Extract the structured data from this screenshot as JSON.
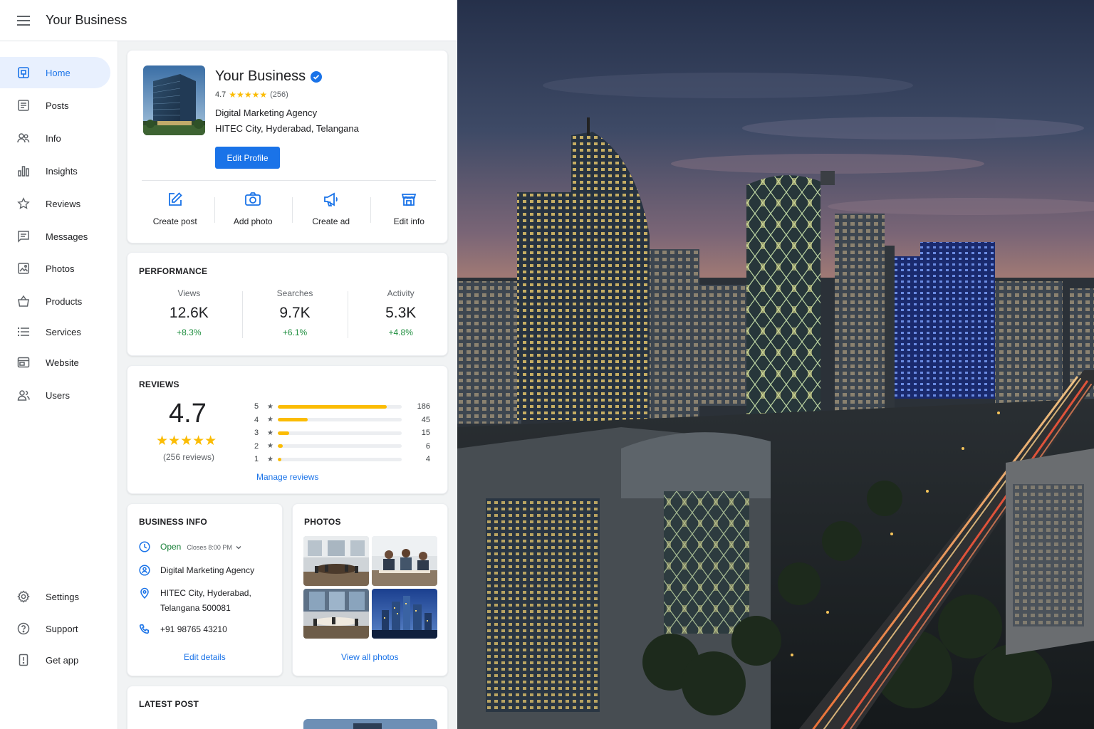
{
  "topbar": {
    "title": "Your Business"
  },
  "sidebar": {
    "items": [
      {
        "label": "Home",
        "icon": "home-icon",
        "active": true
      },
      {
        "label": "Posts",
        "icon": "posts-icon"
      },
      {
        "label": "Info",
        "icon": "info-icon"
      },
      {
        "label": "Insights",
        "icon": "insights-icon"
      },
      {
        "label": "Reviews",
        "icon": "star-icon"
      },
      {
        "label": "Messages",
        "icon": "messages-icon"
      },
      {
        "label": "Photos",
        "icon": "photos-icon"
      },
      {
        "label": "Products",
        "icon": "products-icon"
      },
      {
        "label": "Services",
        "icon": "services-icon"
      },
      {
        "label": "Website",
        "icon": "website-icon"
      },
      {
        "label": "Users",
        "icon": "users-icon"
      }
    ],
    "footer": [
      {
        "label": "Settings",
        "icon": "gear-icon"
      },
      {
        "label": "Support",
        "icon": "help-icon"
      },
      {
        "label": "Get app",
        "icon": "phone-icon"
      }
    ]
  },
  "profile": {
    "name": "Your Business",
    "rating": "4.7",
    "stars": "★★★★★",
    "rating_count": "(256)",
    "category": "Digital Marketing Agency",
    "address": "HITEC City, Hyderabad, Telangana",
    "edit_button": "Edit Profile",
    "actions": [
      {
        "label": "Create post",
        "icon": "edit-icon"
      },
      {
        "label": "Add photo",
        "icon": "camera-icon"
      },
      {
        "label": "Create ad",
        "icon": "megaphone-icon"
      },
      {
        "label": "Edit info",
        "icon": "storefront-icon"
      }
    ]
  },
  "performance": {
    "title": "PERFORMANCE",
    "metrics": [
      {
        "label": "Views",
        "value": "12.6K",
        "change": "+8.3%"
      },
      {
        "label": "Searches",
        "value": "9.7K",
        "change": "+6.1%"
      },
      {
        "label": "Activity",
        "value": "5.3K",
        "change": "+4.8%"
      }
    ]
  },
  "reviews": {
    "title": "REVIEWS",
    "rating": "4.7",
    "stars": "★★★★★",
    "total": "(256 reviews)",
    "breakdown": [
      {
        "stars": "5",
        "count": "186",
        "fraction": 0.88
      },
      {
        "stars": "4",
        "count": "45",
        "fraction": 0.24
      },
      {
        "stars": "3",
        "count": "15",
        "fraction": 0.09
      },
      {
        "stars": "2",
        "count": "6",
        "fraction": 0.04
      },
      {
        "stars": "1",
        "count": "4",
        "fraction": 0.03
      }
    ],
    "star_glyph": "★",
    "manage_link": "Manage reviews"
  },
  "business_info": {
    "title": "BUSINESS INFO",
    "open": "Open",
    "closes": "Closes 8:00 PM",
    "category": "Digital Marketing Agency",
    "address_line1": "HITEC City, Hyderabad,",
    "address_line2": "Telangana 500081",
    "phone": "+91 98765 43210",
    "edit_link": "Edit details"
  },
  "photos": {
    "title": "PHOTOS",
    "view_all": "View all photos"
  },
  "latest_post": {
    "title": "LATEST POST"
  },
  "colors": {
    "accent": "#1a73e8",
    "positive": "#1e8e3e",
    "star": "#fbbc04"
  }
}
